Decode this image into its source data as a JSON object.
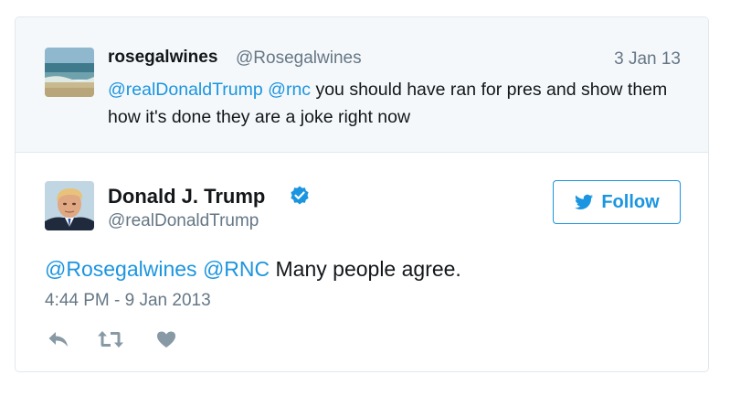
{
  "parent_tweet": {
    "display_name": "rosegalwines",
    "handle": "@Rosegalwines",
    "date": "3 Jan 13",
    "mention_1": "@realDonaldTrump",
    "mention_2": "@rnc",
    "body": " you should have ran for pres and show them how it's done they are a joke right now",
    "avatar_icon": "beach-photo-avatar"
  },
  "main_tweet": {
    "display_name": "Donald J. Trump",
    "handle": "@realDonaldTrump",
    "verified_icon": "verified-badge-icon",
    "follow_label": "Follow",
    "mention_1": "@Rosegalwines",
    "mention_2": "@RNC",
    "body": " Many people agree.",
    "timestamp": "4:44 PM - 9 Jan 2013",
    "avatar_icon": "portrait-photo-avatar"
  },
  "actions": {
    "reply_icon": "reply-icon",
    "retweet_icon": "retweet-icon",
    "like_icon": "heart-icon"
  },
  "colors": {
    "link": "#1b95e0",
    "text": "#14171a",
    "muted": "#657786",
    "icon": "#8899a6",
    "parent_bg": "#f5f8fa"
  }
}
